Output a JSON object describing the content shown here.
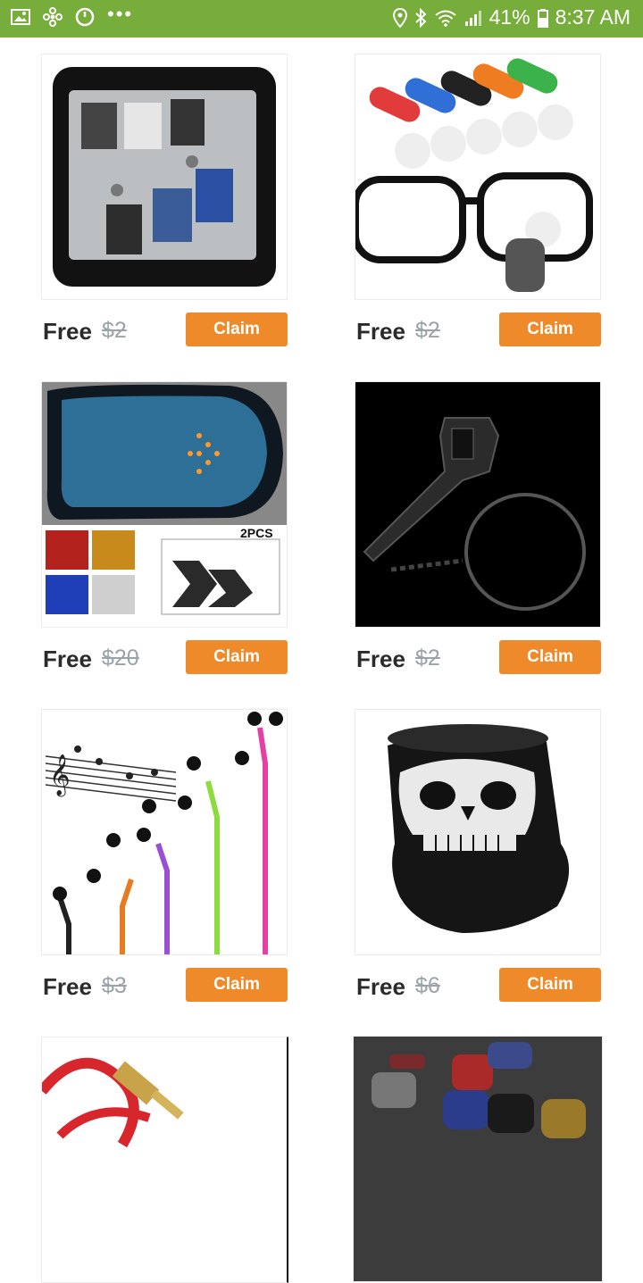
{
  "status_bar": {
    "battery": "41%",
    "time": "8:37 AM"
  },
  "products": [
    {
      "label": "Free",
      "old_price": "$2",
      "button": "Claim",
      "icon": "memory-card-case"
    },
    {
      "label": "Free",
      "old_price": "$2",
      "button": "Claim",
      "icon": "glasses-cleaner"
    },
    {
      "label": "Free",
      "old_price": "$20",
      "button": "Claim",
      "icon": "mirror-led-arrow",
      "image_text": "2PCS"
    },
    {
      "label": "Free",
      "old_price": "$2",
      "button": "Claim",
      "icon": "wrench-keychain"
    },
    {
      "label": "Free",
      "old_price": "$3",
      "button": "Claim",
      "icon": "zipper-earphones"
    },
    {
      "label": "Free",
      "old_price": "$6",
      "button": "Claim",
      "icon": "skull-face-mask"
    }
  ],
  "partial_products": [
    {
      "icon": "audio-cable"
    },
    {
      "icon": "valve-caps"
    }
  ],
  "colors": {
    "status_bar": "#77ad3a",
    "claim_button": "#ef8a2b"
  }
}
